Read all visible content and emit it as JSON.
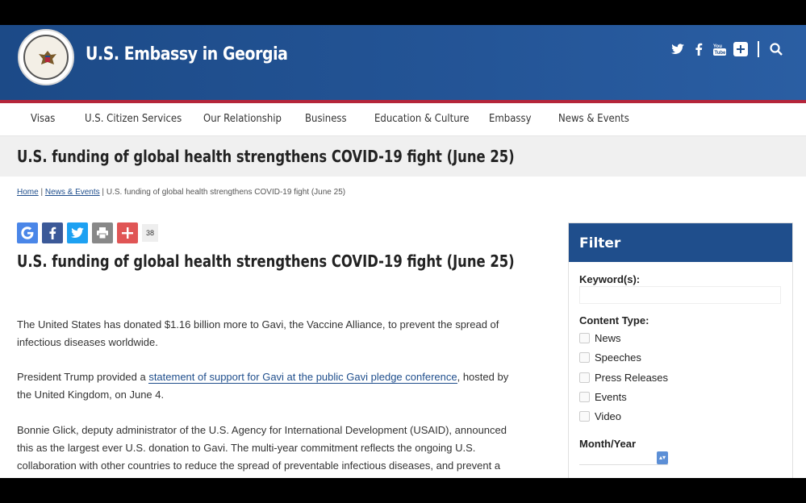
{
  "header": {
    "site_title": "U.S. Embassy in Georgia",
    "social_icons": [
      "twitter-icon",
      "facebook-icon",
      "youtube-icon",
      "plus-icon",
      "search-icon"
    ]
  },
  "nav": {
    "items": [
      {
        "label": "Visas"
      },
      {
        "label": "U.S. Citizen Services"
      },
      {
        "label": "Our Relationship"
      },
      {
        "label": "Business"
      },
      {
        "label": "Education & Culture"
      },
      {
        "label": "Embassy"
      },
      {
        "label": "News & Events"
      }
    ]
  },
  "page": {
    "title": "U.S. funding of global health strengthens COVID-19 fight (June 25)"
  },
  "breadcrumb": {
    "home": "Home",
    "sep": " | ",
    "section": "News & Events",
    "current": "U.S. funding of global health strengthens COVID-19 fight (June 25)"
  },
  "share": {
    "count": "38"
  },
  "article": {
    "title": "U.S. funding of global health strengthens COVID-19 fight (June 25)",
    "p1": "The United States has donated $1.16 billion more to Gavi, the Vaccine Alliance, to prevent the spread of infectious diseases worldwide.",
    "p2_pre": "President Trump provided a ",
    "p2_link": "statement of support for Gavi at the public Gavi pledge conference",
    "p2_post": ", hosted by the United Kingdom, on June 4.",
    "p3": "Bonnie Glick, deputy administrator of the U.S. Agency for International Development (USAID), announced this as the largest ever U.S. donation to Gavi. The multi-year commitment reflects the ongoing U.S. collaboration with other countries to reduce the spread of preventable infectious diseases, and prevent a"
  },
  "filter": {
    "title": "Filter",
    "keyword_label": "Keyword(s):",
    "keyword_value": "",
    "content_type_label": "Content Type:",
    "content_types": [
      "News",
      "Speeches",
      "Press Releases",
      "Events",
      "Video"
    ],
    "month_year_label": "Month/Year",
    "month_year_value": ""
  },
  "colors": {
    "header_blue": "#1f4e8c",
    "accent_red": "#b5253a"
  }
}
